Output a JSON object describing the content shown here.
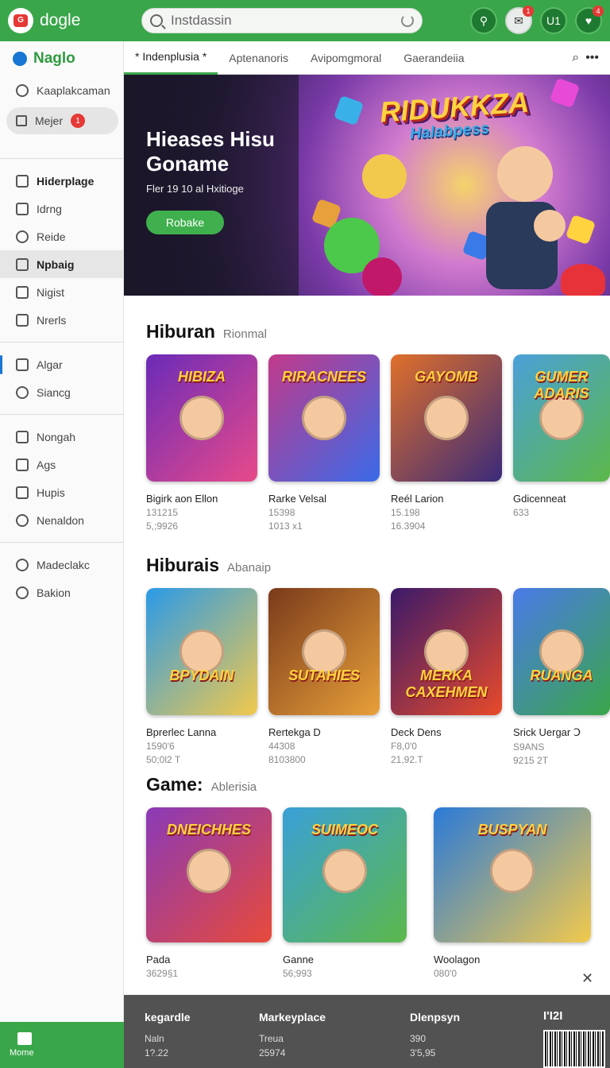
{
  "app": {
    "name": "dogle",
    "search_value": "Instdassin"
  },
  "top_actions": [
    {
      "icon": "controller-icon",
      "label": "",
      "badge": ""
    },
    {
      "icon": "chat-icon",
      "label": "",
      "badge": "1"
    },
    {
      "icon": "user-icon",
      "label": "U1",
      "badge": ""
    },
    {
      "icon": "gift-icon",
      "label": "",
      "badge": "4"
    }
  ],
  "sidebar": {
    "brand": "Naglo",
    "search_item": "Kaaplakcaman",
    "pill": {
      "label": "Mejer",
      "badge": "1"
    },
    "group1": [
      "Hiderplage",
      "Idrng",
      "Reide",
      "Npbaig",
      "Nigist",
      "Nrerls"
    ],
    "group2": [
      "Algar",
      "Siancg"
    ],
    "group3": [
      "Nongah",
      "Ags",
      "Hupis",
      "Nenaldon"
    ],
    "group4": [
      "Madeclakc",
      "Bakion"
    ],
    "bottom_label": "Mome"
  },
  "tabs": [
    "* Indenplusia *",
    "Aptenanoris",
    "Avipomgmoral",
    "Gaerandeiia"
  ],
  "hero": {
    "title": "Hieases Hisu Goname",
    "subtitle": "Fler 19 10 al Hxitioge",
    "button": "Robake",
    "logo": "RIDUKKZA",
    "logo_sub": "Halabpess"
  },
  "sections": [
    {
      "title": "Hiburan",
      "subtitle": "Rionmal",
      "cards": [
        {
          "art": "HIBIZA",
          "name": "Bigirk aon Ellon",
          "m1": "131215",
          "m2": "5,;9926",
          "color": "#6a2bb8",
          "color2": "#e84a8a"
        },
        {
          "art": "RIRACNEES",
          "name": "Rarke Velsal",
          "m1": "15398",
          "m2": "1013 x1",
          "color": "#c23a8a",
          "color2": "#3a6ae8"
        },
        {
          "art": "GAYOMB",
          "name": "Reél Larion",
          "m1": "15.198",
          "m2": "16.3904",
          "color": "#e0702a",
          "color2": "#3a2a7a"
        },
        {
          "art": "GUMER ADARIS",
          "name": "Gdicenneat",
          "m1": "633",
          "m2": "",
          "color": "#4aa0d8",
          "color2": "#5cb84a"
        }
      ]
    },
    {
      "title": "Hiburais",
      "subtitle": "Abanaip",
      "cards": [
        {
          "art": "BPYDAIN",
          "name": "Bprerlec Lanna",
          "m1": "1590'6",
          "m2": "50;0l2 T",
          "color": "#2a9ae8",
          "color2": "#f2c94c"
        },
        {
          "art": "SUTAHIES",
          "name": "Rertekga D",
          "m1": "44308",
          "m2": "8103800",
          "color": "#7a3a1a",
          "color2": "#e8a03a"
        },
        {
          "art": "MERKA CAXEHMEN",
          "name": "Deck Dens",
          "m1": "F8,0'0",
          "m2": "21,92.T",
          "color": "#3a1a6a",
          "color2": "#e84a2a"
        },
        {
          "art": "RUANGA",
          "name": "Srick Uergar Ↄ",
          "m1": "S9ANS",
          "m2": "9215 2T",
          "color": "#4a7ae8",
          "color2": "#3aa64a"
        }
      ]
    },
    {
      "title": "Game:",
      "subtitle": "Ablerisia",
      "cards": [
        {
          "art": "DNEICHHES",
          "name": "Pada",
          "m1": "3629§1",
          "m2": "",
          "color": "#8a3ab8",
          "color2": "#e84a3a"
        },
        {
          "art": "SUIMEOC",
          "name": "Ganne",
          "m1": "56;993",
          "m2": "",
          "color": "#3aa0d8",
          "color2": "#5cb84a"
        },
        {
          "art": "BUSPYAN",
          "name": "Woolagon",
          "m1": "080'0",
          "m2": "",
          "color": "#2a7ad8",
          "color2": "#f2c94c"
        }
      ]
    }
  ],
  "footer": {
    "cols": [
      {
        "h": "kegardle",
        "l1": "Naln",
        "l2": "1?.22"
      },
      {
        "h": "Markeyplace",
        "l1": "Treua",
        "l2": "25974"
      },
      {
        "h": "Dlenpsyn",
        "l1": "390",
        "l2": "3'5,95"
      }
    ],
    "corner": "I'I2I"
  }
}
